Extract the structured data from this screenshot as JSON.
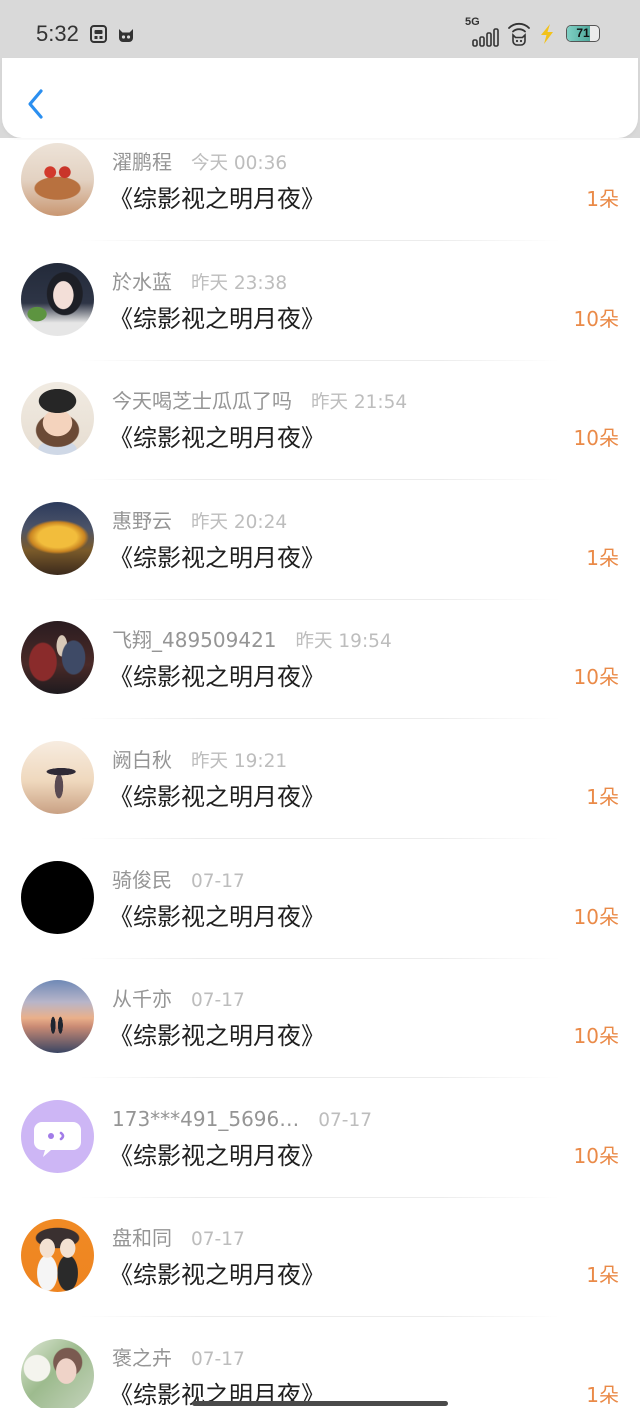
{
  "status_bar": {
    "time": "5:32",
    "network_label": "5G",
    "battery_level": "71",
    "icons": [
      "sim-card-icon",
      "cat-face-icon",
      "signal-icon",
      "wifi-icon",
      "lightning-icon",
      "battery-icon"
    ]
  },
  "header": {
    "back_icon": "chevron-left-icon"
  },
  "gift_list": [
    {
      "name": "濯鹏程",
      "time": "今天 00:36",
      "title": "《综影视之明月夜》",
      "amount": "1朵"
    },
    {
      "name": "於水蓝",
      "time": "昨天 23:38",
      "title": "《综影视之明月夜》",
      "amount": "10朵"
    },
    {
      "name": "今天喝芝士瓜瓜了吗",
      "time": "昨天 21:54",
      "title": "《综影视之明月夜》",
      "amount": "10朵"
    },
    {
      "name": "惠野云",
      "time": "昨天 20:24",
      "title": "《综影视之明月夜》",
      "amount": "1朵"
    },
    {
      "name": "飞翔_489509421",
      "time": "昨天 19:54",
      "title": "《综影视之明月夜》",
      "amount": "10朵"
    },
    {
      "name": "阙白秋",
      "time": "昨天 19:21",
      "title": "《综影视之明月夜》",
      "amount": "1朵"
    },
    {
      "name": "骑俊民",
      "time": "07-17",
      "title": "《综影视之明月夜》",
      "amount": "10朵"
    },
    {
      "name": "从千亦",
      "time": "07-17",
      "title": "《综影视之明月夜》",
      "amount": "10朵"
    },
    {
      "name": "173***491_5696…",
      "time": "07-17",
      "title": "《综影视之明月夜》",
      "amount": "10朵"
    },
    {
      "name": "盘和同",
      "time": "07-17",
      "title": "《综影视之明月夜》",
      "amount": "1朵"
    },
    {
      "name": "褒之卉",
      "time": "07-17",
      "title": "《综影视之明月夜》",
      "amount": "1朵"
    }
  ],
  "colors": {
    "status_bar_bg": "#d9d9d9",
    "accent_blue": "#2b8ff0",
    "amount_orange": "#ea8a48",
    "name_gray": "#959595",
    "time_gray": "#bdbdbd",
    "title_text": "#1f1f1f"
  }
}
